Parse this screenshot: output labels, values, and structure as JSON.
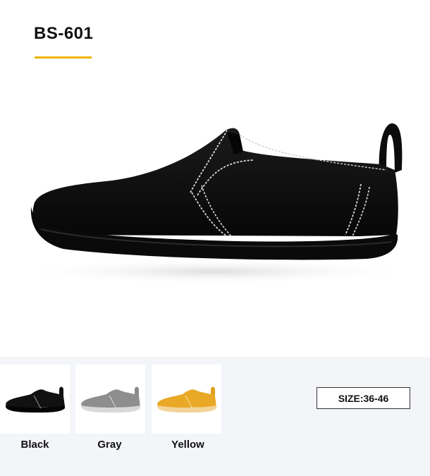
{
  "product": {
    "title": "BS-601",
    "accent_color": "#f0b400",
    "hero_image": "black-slip-on-shoe"
  },
  "variants": {
    "items": [
      {
        "label": "Black",
        "color": "#111111",
        "sole": "#0a0a0a"
      },
      {
        "label": "Gray",
        "color": "#8e8e8e",
        "sole": "#d8d8d8"
      },
      {
        "label": "Yellow",
        "color": "#e9a825",
        "sole": "#f2d39a"
      }
    ]
  },
  "size": {
    "label": "SIZE:36-46"
  }
}
